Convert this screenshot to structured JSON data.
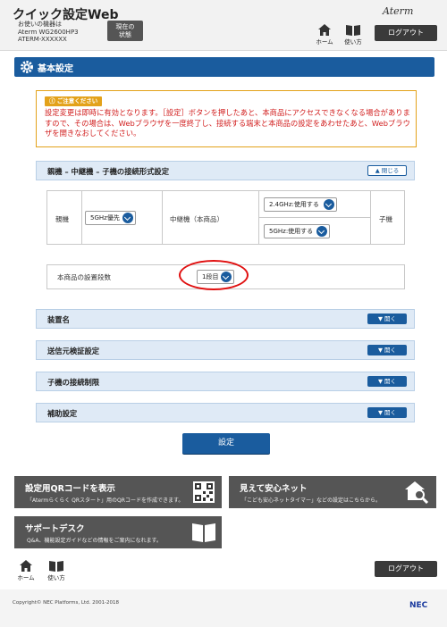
{
  "header": {
    "app_title": "クイック設定Web",
    "device_line1": "お使いの機器は",
    "device_line2": "Aterm WG2600HP3",
    "device_line3": "ATERM-XXXXXX",
    "status_label_1": "現在の",
    "status_label_2": "状態",
    "brand": "Aterm",
    "home_label": "ホーム",
    "help_label": "使い方",
    "logout_label": "ログアウト"
  },
  "page": {
    "title": "基本設定"
  },
  "caution": {
    "badge": "ご注意ください",
    "text": "設定変更は即時に有効となります。［設定］ボタンを押したあと、本商品にアクセスできなくなる場合がありますので、その場合は、Webブラウザを一度終了し、接続する端末と本商品の設定をあわせたあと、Webブラウザを開きなおしてください。"
  },
  "connection_section": {
    "label": "親機 – 中継機 – 子機の接続形式設定",
    "toggle_label": "閉じる",
    "parent_label": "親機",
    "parent_select": "5GHz優先",
    "repeater_label": "中継機（本商品）",
    "band24_select": "2.4GHz:使用する",
    "band5_select": "5GHz:使用する",
    "child_label": "子機"
  },
  "install": {
    "label": "本商品の設置段数",
    "select": "1段目"
  },
  "sections": [
    {
      "label": "装置名",
      "toggle_label": "開く"
    },
    {
      "label": "送信元検証設定",
      "toggle_label": "開く"
    },
    {
      "label": "子機の接続制限",
      "toggle_label": "開く"
    },
    {
      "label": "補助設定",
      "toggle_label": "開く"
    }
  ],
  "apply_label": "設定",
  "cards": {
    "qr": {
      "title": "設定用QRコードを表示",
      "sub": "「Atermらくらく QRスタート」用のQRコードを作成できます。"
    },
    "safe": {
      "title": "見えて安心ネット",
      "sub": "「こども安心ネットタイマー」などの設定はこちらから。"
    },
    "support": {
      "title": "サポートデスク",
      "sub": "Q&A、機能設定ガイドなどの情報をご案内になれます。"
    }
  },
  "footer": {
    "home_label": "ホーム",
    "help_label": "使い方",
    "logout_label": "ログアウト",
    "copyright": "Copyright© NEC Platforms, Ltd. 2001-2018",
    "nec": "NEC"
  },
  "colors": {
    "primary": "#1a5c9e",
    "caution": "#e3a21a",
    "alert_text": "#d22020",
    "card": "#555555"
  }
}
